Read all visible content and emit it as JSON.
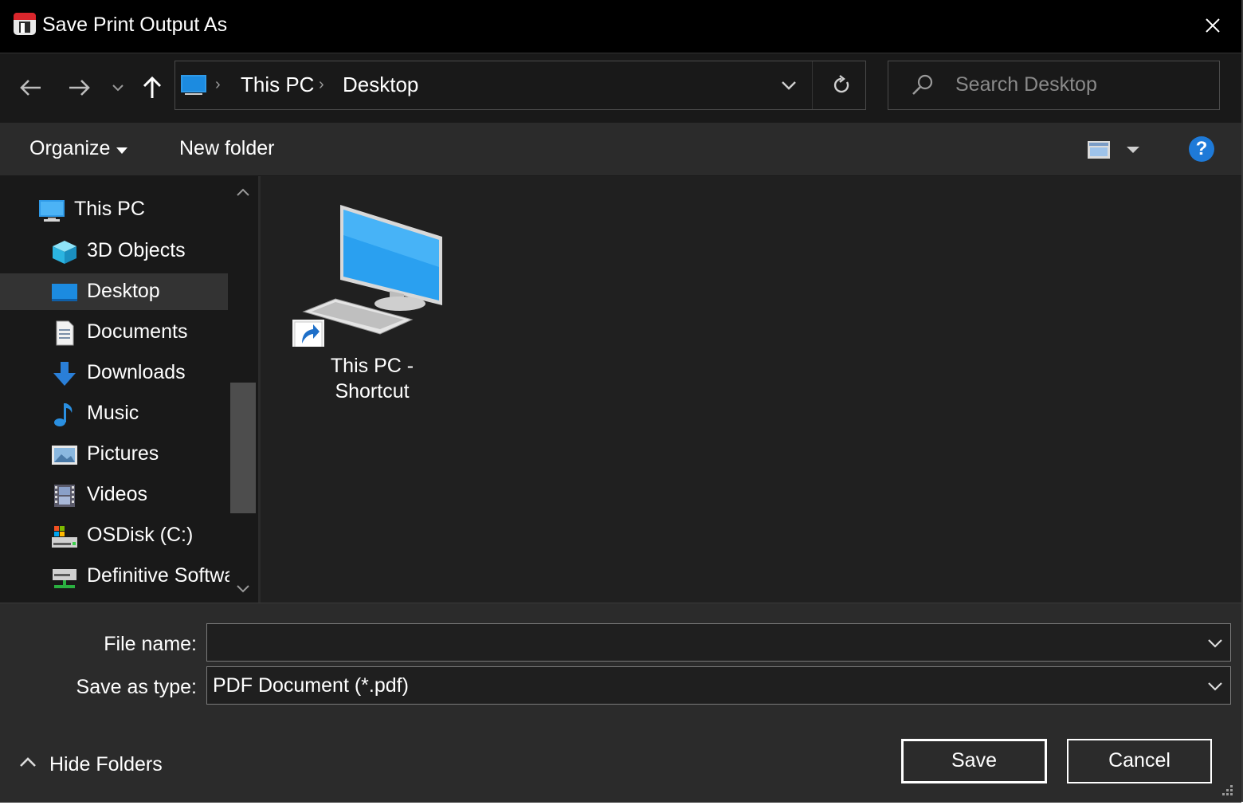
{
  "window": {
    "title": "Save Print Output As",
    "app_icon": "parallels-app-icon",
    "close_icon": "close-icon"
  },
  "navigation": {
    "back_icon": "arrow-left-icon",
    "forward_icon": "arrow-right-icon",
    "recent_icon": "chevron-down-icon",
    "up_icon": "arrow-up-icon",
    "breadcrumbs": [
      "This PC",
      "Desktop"
    ],
    "refresh_icon": "refresh-icon",
    "search_placeholder": "Search Desktop"
  },
  "toolbar": {
    "organize_label": "Organize",
    "new_folder_label": "New folder",
    "view_icon": "view-options-icon",
    "help_icon": "help-icon",
    "help_glyph": "?"
  },
  "sidebar": {
    "items": [
      {
        "label": "This PC",
        "icon": "this-pc-icon"
      },
      {
        "label": "3D Objects",
        "icon": "3d-objects-icon"
      },
      {
        "label": "Desktop",
        "icon": "desktop-icon",
        "selected": true
      },
      {
        "label": "Documents",
        "icon": "documents-icon"
      },
      {
        "label": "Downloads",
        "icon": "downloads-icon"
      },
      {
        "label": "Music",
        "icon": "music-icon"
      },
      {
        "label": "Pictures",
        "icon": "pictures-icon"
      },
      {
        "label": "Videos",
        "icon": "videos-icon"
      },
      {
        "label": "OSDisk (C:)",
        "icon": "drive-icon"
      },
      {
        "label": "Definitive Softwa",
        "icon": "network-drive-icon"
      }
    ]
  },
  "content": {
    "items": [
      {
        "line1": "This PC -",
        "line2": "Shortcut",
        "icon": "computer-shortcut-icon"
      }
    ]
  },
  "form": {
    "file_name_label": "File name:",
    "file_name_value": "",
    "save_as_type_label": "Save as type:",
    "save_as_type_value": "PDF Document (*.pdf)"
  },
  "footer": {
    "hide_folders_label": "Hide Folders",
    "save_label": "Save",
    "cancel_label": "Cancel"
  },
  "colors": {
    "title_bar": "#000000",
    "window_bg": "#191919",
    "toolbar_bg": "#2b2b2b",
    "content_bg": "#202020",
    "accent": "#1e7ad8"
  }
}
